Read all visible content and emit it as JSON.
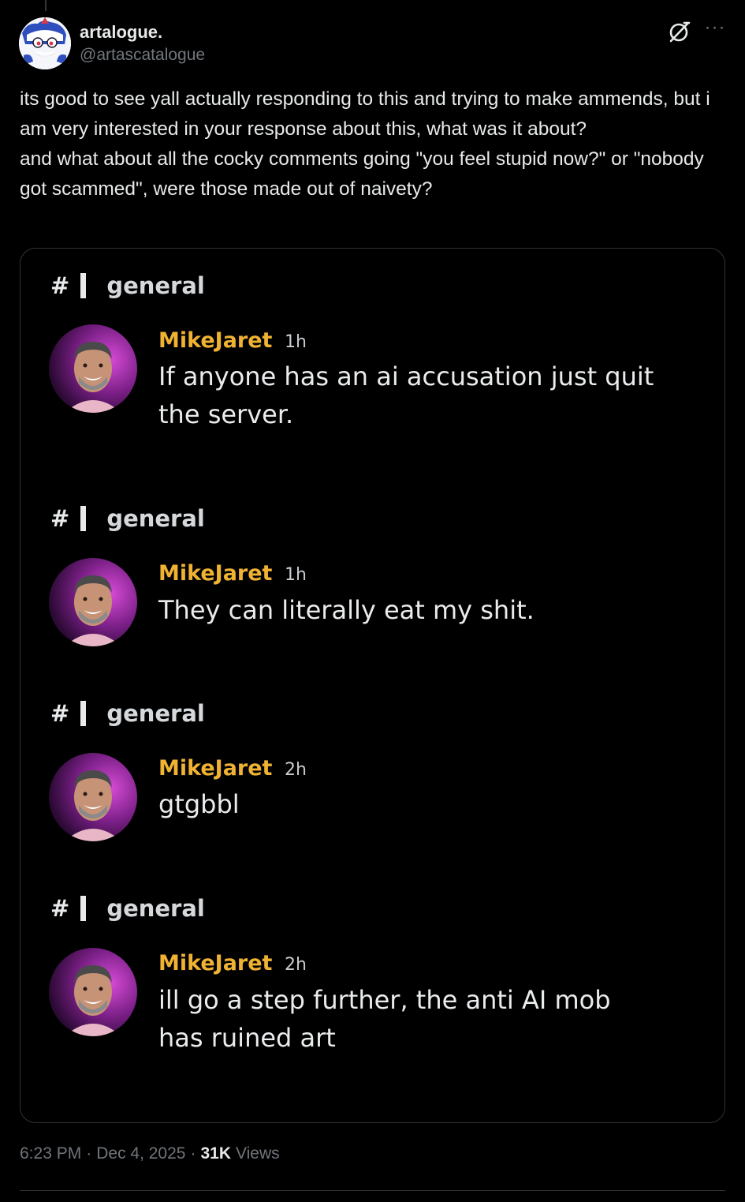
{
  "author": {
    "display_name": "artalogue.",
    "handle": "@artascatalogue"
  },
  "icons": {
    "grok": "grok-icon",
    "more": "more-icon"
  },
  "tweet": {
    "lines": [
      "its good to see yall actually responding to this and trying to make ammends, but i am very interested in your response about this, what was it about?",
      "and what about all the cocky comments going \"you feel stupid now?\" or \"nobody got scammed\", were those made out of naivety?"
    ]
  },
  "media": {
    "messages": [
      {
        "channel_hash": "#",
        "channel": "general",
        "user": "MikeJaret",
        "time": "1h",
        "text": "If anyone has an ai accusation just quit the server."
      },
      {
        "channel_hash": "#",
        "channel": "general",
        "user": "MikeJaret",
        "time": "1h",
        "text": "They can literally eat my shit."
      },
      {
        "channel_hash": "#",
        "channel": "general",
        "user": "MikeJaret",
        "time": "2h",
        "text": "gtgbbl"
      },
      {
        "channel_hash": "#",
        "channel": "general",
        "user": "MikeJaret",
        "time": "2h",
        "text": "ill go a step further, the anti AI mob has ruined art"
      }
    ],
    "username_color": "#f0b232"
  },
  "footer": {
    "time": "6:23 PM",
    "separator": "·",
    "date": "Dec 4, 2025",
    "views_count": "31K",
    "views_label": "Views"
  }
}
